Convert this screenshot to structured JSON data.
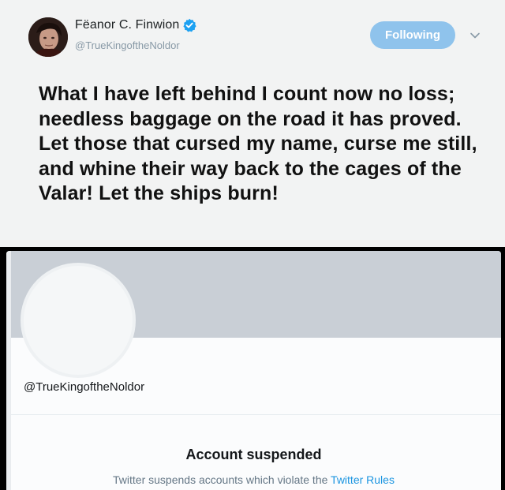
{
  "tweet": {
    "display_name": "Fëanor C. Finwion",
    "handle": "@TrueKingoftheNoldor",
    "follow_button_label": "Following",
    "text": "What I have left behind I count now no loss; needless baggage on the road it has proved. Let those that cursed my name, curse me still, and whine their way back to the cages of the Valar! Let the ships burn!",
    "icons": {
      "verified": "verified-badge-icon",
      "more": "chevron-down-icon"
    },
    "colors": {
      "follow_button": "#8fc3ec",
      "verified": "#1da1f2"
    }
  },
  "profile": {
    "handle": "@TrueKingoftheNoldor",
    "status_title": "Account suspended",
    "status_description": "Twitter suspends accounts which violate the",
    "rules_link": "Twitter Rules",
    "colors": {
      "banner": "#c9cfd6",
      "link": "#1b95e0"
    }
  }
}
